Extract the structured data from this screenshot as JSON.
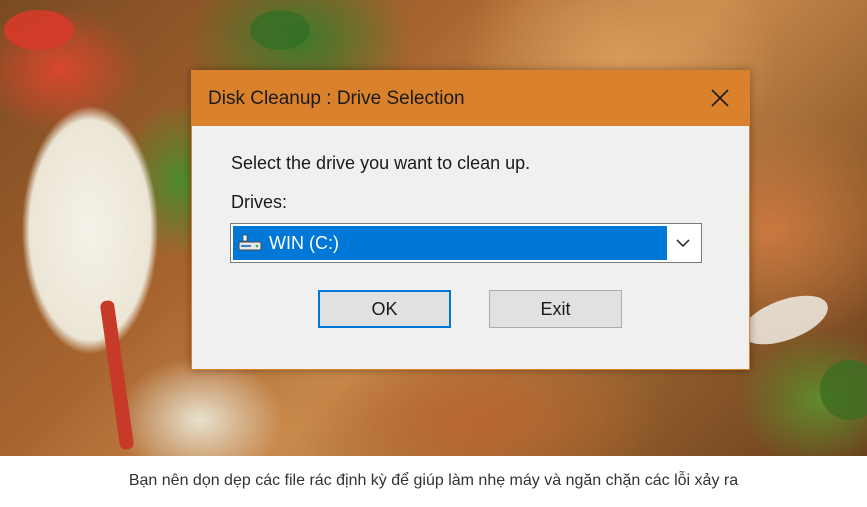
{
  "dialog": {
    "title": "Disk Cleanup : Drive Selection",
    "close_icon": "close-icon",
    "prompt": "Select the drive you want to clean up.",
    "drives_label": "Drives:",
    "drive_select": {
      "selected": "WIN (C:)",
      "icon": "drive-icon"
    },
    "ok_label": "OK",
    "exit_label": "Exit",
    "accent_color": "#d9822b",
    "selection_color": "#0078d7"
  },
  "caption": "Bạn nên dọn dẹp các file rác định kỳ để giúp làm nhẹ máy và ngăn chặn các lỗi xảy ra"
}
